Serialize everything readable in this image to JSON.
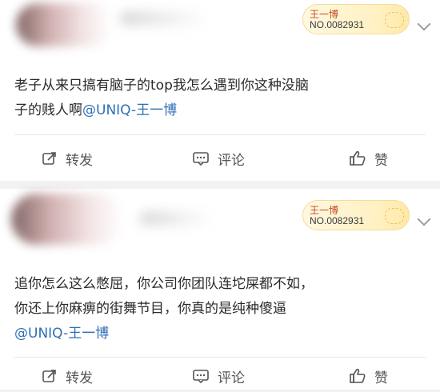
{
  "posts": [
    {
      "badge": {
        "name": "王一博",
        "number": "NO.0082931"
      },
      "content": {
        "line1": "老子从来只搞有脑子的top我怎么遇到你这种没脑",
        "line2_prefix": "子的贱人啊",
        "mention": "@UNIQ-王一博"
      },
      "actions": {
        "repost": "转发",
        "comment": "评论",
        "like": "赞"
      }
    },
    {
      "badge": {
        "name": "王一博",
        "number": "NO.0082931"
      },
      "content": {
        "line1": "追你怎么这么憋屈，你公司你团队连坨屎都不如，",
        "line2": "你还上你麻痹的街舞节目，你真的是纯种傻逼",
        "mention": "@UNIQ-王一博"
      },
      "actions": {
        "repost": "转发",
        "comment": "评论",
        "like": "赞"
      }
    }
  ],
  "colors": {
    "mention": "#2f6fb5",
    "badge_name": "#c24a1f",
    "background": "#f2f2f2"
  },
  "icons": [
    "repost-icon",
    "comment-icon",
    "like-icon",
    "chevron-down-icon"
  ]
}
